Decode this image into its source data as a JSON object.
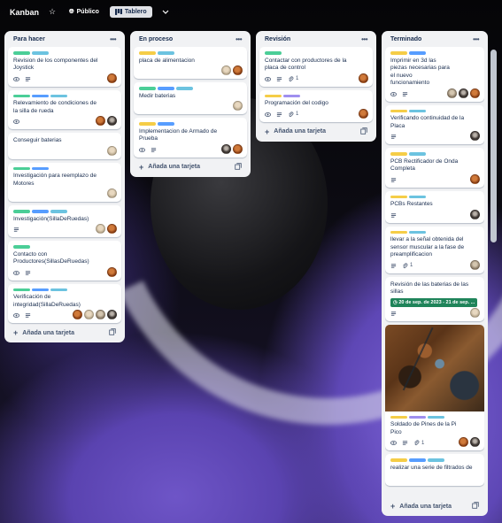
{
  "header": {
    "board_title": "Kanban",
    "visibility_label": "Público",
    "view_label": "Tablero"
  },
  "colors": {
    "green": "#4bce97",
    "teal": "#6cc3e0",
    "yellow": "#f5cd47",
    "blue": "#579dff",
    "purple": "#9f8fef",
    "date_green": "#1f845a"
  },
  "add_card_label": "Añada una tarjeta",
  "lists": [
    {
      "title": "Para hacer",
      "cards": [
        {
          "labels": [
            "green",
            "teal"
          ],
          "title": "Revision de los componentes del Joystick",
          "badges": [
            "watch",
            "description"
          ],
          "members": [
            "brown"
          ]
        },
        {
          "labels": [
            "green",
            "blue",
            "teal"
          ],
          "title": "Relevamiento de condiciones de la silla de rueda",
          "badges": [
            "watch"
          ],
          "members": [
            "brown",
            "dark"
          ]
        },
        {
          "labels": [],
          "title": "Conseguir baterias",
          "badges": [],
          "members": [
            "light"
          ]
        },
        {
          "labels": [
            "green",
            "blue"
          ],
          "title": "Investigación para reemplazo de Motores",
          "badges": [],
          "members": [
            "light"
          ]
        },
        {
          "labels": [
            "green",
            "blue",
            "teal"
          ],
          "title": "Investigación(SillaDeRuedas)",
          "badges": [
            "description"
          ],
          "members": [
            "light",
            "brown"
          ]
        },
        {
          "labels": [
            "green"
          ],
          "title": "Contacto con Productores(SillasDeRuedas)",
          "badges": [
            "watch",
            "description"
          ],
          "members": [
            "brown"
          ]
        },
        {
          "labels": [
            "green",
            "blue",
            "teal"
          ],
          "title": "Verificación de integridad(SillaDeRuedas)",
          "badges": [
            "watch",
            "description"
          ],
          "members": [
            "brown",
            "light",
            "light2",
            "dark"
          ]
        }
      ]
    },
    {
      "title": "En proceso",
      "cards": [
        {
          "labels": [
            "yellow",
            "teal"
          ],
          "title": "placa de alimentacion",
          "badges": [],
          "members": [
            "light",
            "brown"
          ]
        },
        {
          "labels": [
            "green",
            "blue",
            "teal"
          ],
          "title": "Medir baterias",
          "badges": [],
          "members": [
            "light"
          ]
        },
        {
          "labels": [
            "yellow",
            "blue"
          ],
          "title": "Implementacion de Armado de Prueba",
          "badges": [
            "watch",
            "description"
          ],
          "members": [
            "dark",
            "brown"
          ]
        }
      ]
    },
    {
      "title": "Revisión",
      "cards": [
        {
          "labels": [
            "green"
          ],
          "title": "Contactar con productores de la placa de control",
          "badges": [
            "watch",
            "description",
            "attach"
          ],
          "attach_count": "1",
          "members": [
            "brown"
          ]
        },
        {
          "labels": [
            "yellow",
            "purple"
          ],
          "title": "Programación del codigo",
          "badges": [
            "watch",
            "description",
            "attach"
          ],
          "attach_count": "1",
          "members": [
            "brown"
          ]
        }
      ]
    },
    {
      "title": "Terminado",
      "cards": [
        {
          "labels": [
            "yellow",
            "blue"
          ],
          "title": "Imprimir en 3d las piezas necesarias para el nuevo funcionamiento",
          "badges": [
            "watch",
            "description"
          ],
          "members": [
            "light2",
            "dark",
            "brown"
          ]
        },
        {
          "labels": [
            "yellow",
            "teal"
          ],
          "title": "Verificando continuidad de la Placa",
          "badges": [
            "description"
          ],
          "members": [
            "dark"
          ]
        },
        {
          "labels": [
            "yellow",
            "teal"
          ],
          "title": "PCB Rectificador de Onda Completa",
          "badges": [
            "description"
          ],
          "members": [
            "brown"
          ]
        },
        {
          "labels": [
            "yellow",
            "teal"
          ],
          "title": "PCBs Restantes",
          "badges": [
            "description"
          ],
          "members": [
            "dark"
          ]
        },
        {
          "labels": [
            "yellow",
            "teal"
          ],
          "title": "llevar a la señal obtenida del sensor muscular a la fase de preamplificacion",
          "badges": [
            "description",
            "attach"
          ],
          "attach_count": "1",
          "members": [
            "light2"
          ]
        },
        {
          "labels": [],
          "title": "Revisión de las baterias de las sillas",
          "date": "20 de sep. de 2023 - 21 de sep. ...",
          "badges": [
            "description"
          ],
          "members": [
            "light"
          ]
        },
        {
          "cover": true,
          "labels": [
            "yellow",
            "purple",
            "teal"
          ],
          "title": "Soldado de Pines de la Pi Pico",
          "badges": [
            "watch",
            "description",
            "attach"
          ],
          "attach_count": "1",
          "members": [
            "brown",
            "dark"
          ]
        },
        {
          "labels": [
            "yellow",
            "blue",
            "teal"
          ],
          "title": "realizar una serie de filtrados de",
          "badges": [],
          "members": []
        }
      ]
    }
  ]
}
